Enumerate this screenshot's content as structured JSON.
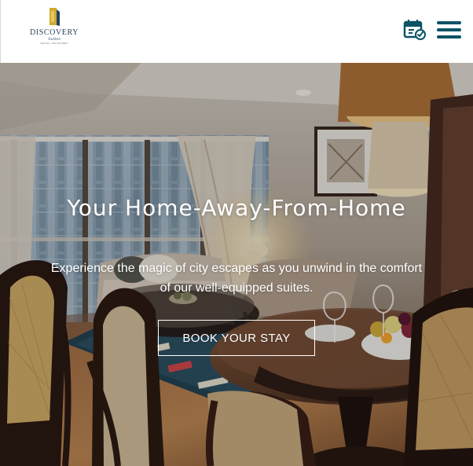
{
  "header": {
    "logo": {
      "brand": "DISCOVERY",
      "script": "Suites",
      "tagline": "MANILA, PHILIPPINES",
      "icon": "discovery-suites-logo"
    },
    "actions": {
      "booking_icon": "calendar-check-icon",
      "menu_icon": "hamburger-menu-icon"
    }
  },
  "hero": {
    "title": "Your Home-Away-From-Home",
    "subtitle": "Experience the magic of city escapes as you unwind in the comfort of our well-equipped suites.",
    "cta_label": "BOOK YOUR STAY"
  },
  "colors": {
    "brand": "#0b5365",
    "logo_gold": "#c8a335",
    "text_overlay": "#ffffff"
  }
}
